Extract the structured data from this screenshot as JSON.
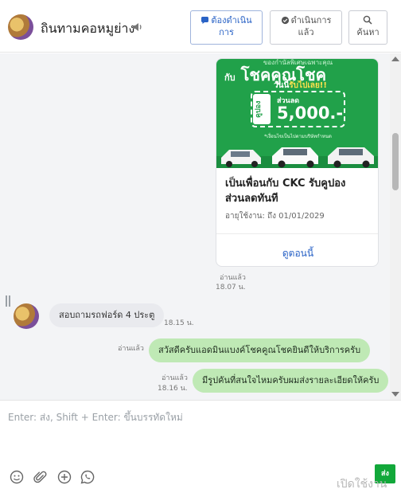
{
  "header": {
    "name": "ถินทามคอหมูย่าง",
    "buttons": {
      "todo_line1": "ต้องดำเนิน",
      "todo_line2": "การ",
      "done_line1": "ดำเนินการ",
      "done_line2": "แล้ว",
      "search_label": "ค้นหา"
    }
  },
  "card": {
    "promo_top": "ของกำนัลพิเศษเฉพาะคุณ",
    "promo_headline_small": "กับ",
    "promo_headline": "โชคคูณโชค",
    "promo_sub_prefix": "วันนี้",
    "promo_sub_highlight": "รับไปเลย!!",
    "coupon_side": "คูปอง",
    "discount_label": "ส่วนลด",
    "discount_amount": "5,000.-",
    "promo_note": "*เงื่อนไขเป็นไปตามบริษัทกำหนด",
    "title": "เป็นเพื่อนกับ CKC รับคูปองส่วนลดทันที",
    "expiry": "อายุใช้งาน: ถึง 01/01/2029",
    "link": "ดูตอนนี้"
  },
  "messages": {
    "card_read": "อ่านแล้ว",
    "card_time": "18.07 น.",
    "incoming_text": "สอบถามรถฟอร์ด 4 ประตู",
    "incoming_time": "18.15 น.",
    "out1_read": "อ่านแล้ว",
    "out1_text": "สวัสดีครับแอดมินแบงค์โชคคูณโชคยินดีให้บริการครับ",
    "out2_read": "อ่านแล้ว",
    "out2_time": "18.16 น.",
    "out2_text": "มีรูปคันที่สนใจไหมครับผมส่งรายละเอียดให้ครับ"
  },
  "composer": {
    "placeholder": "Enter: ส่ง, Shift + Enter: ขึ้นบรรทัดใหม่",
    "send_label": "ส่ง"
  },
  "watermark": "เปิดใช้งาน",
  "colors": {
    "accent_blue": "#2a63c6",
    "bubble_green": "#bfe9b5",
    "card_green": "#21a14a",
    "send_green": "#12a83a"
  },
  "icons": [
    "speaker-icon",
    "chat-bubble-icon",
    "check-chat-icon",
    "search-icon",
    "emoji-icon",
    "attach-icon",
    "add-icon",
    "whatsapp-icon"
  ]
}
